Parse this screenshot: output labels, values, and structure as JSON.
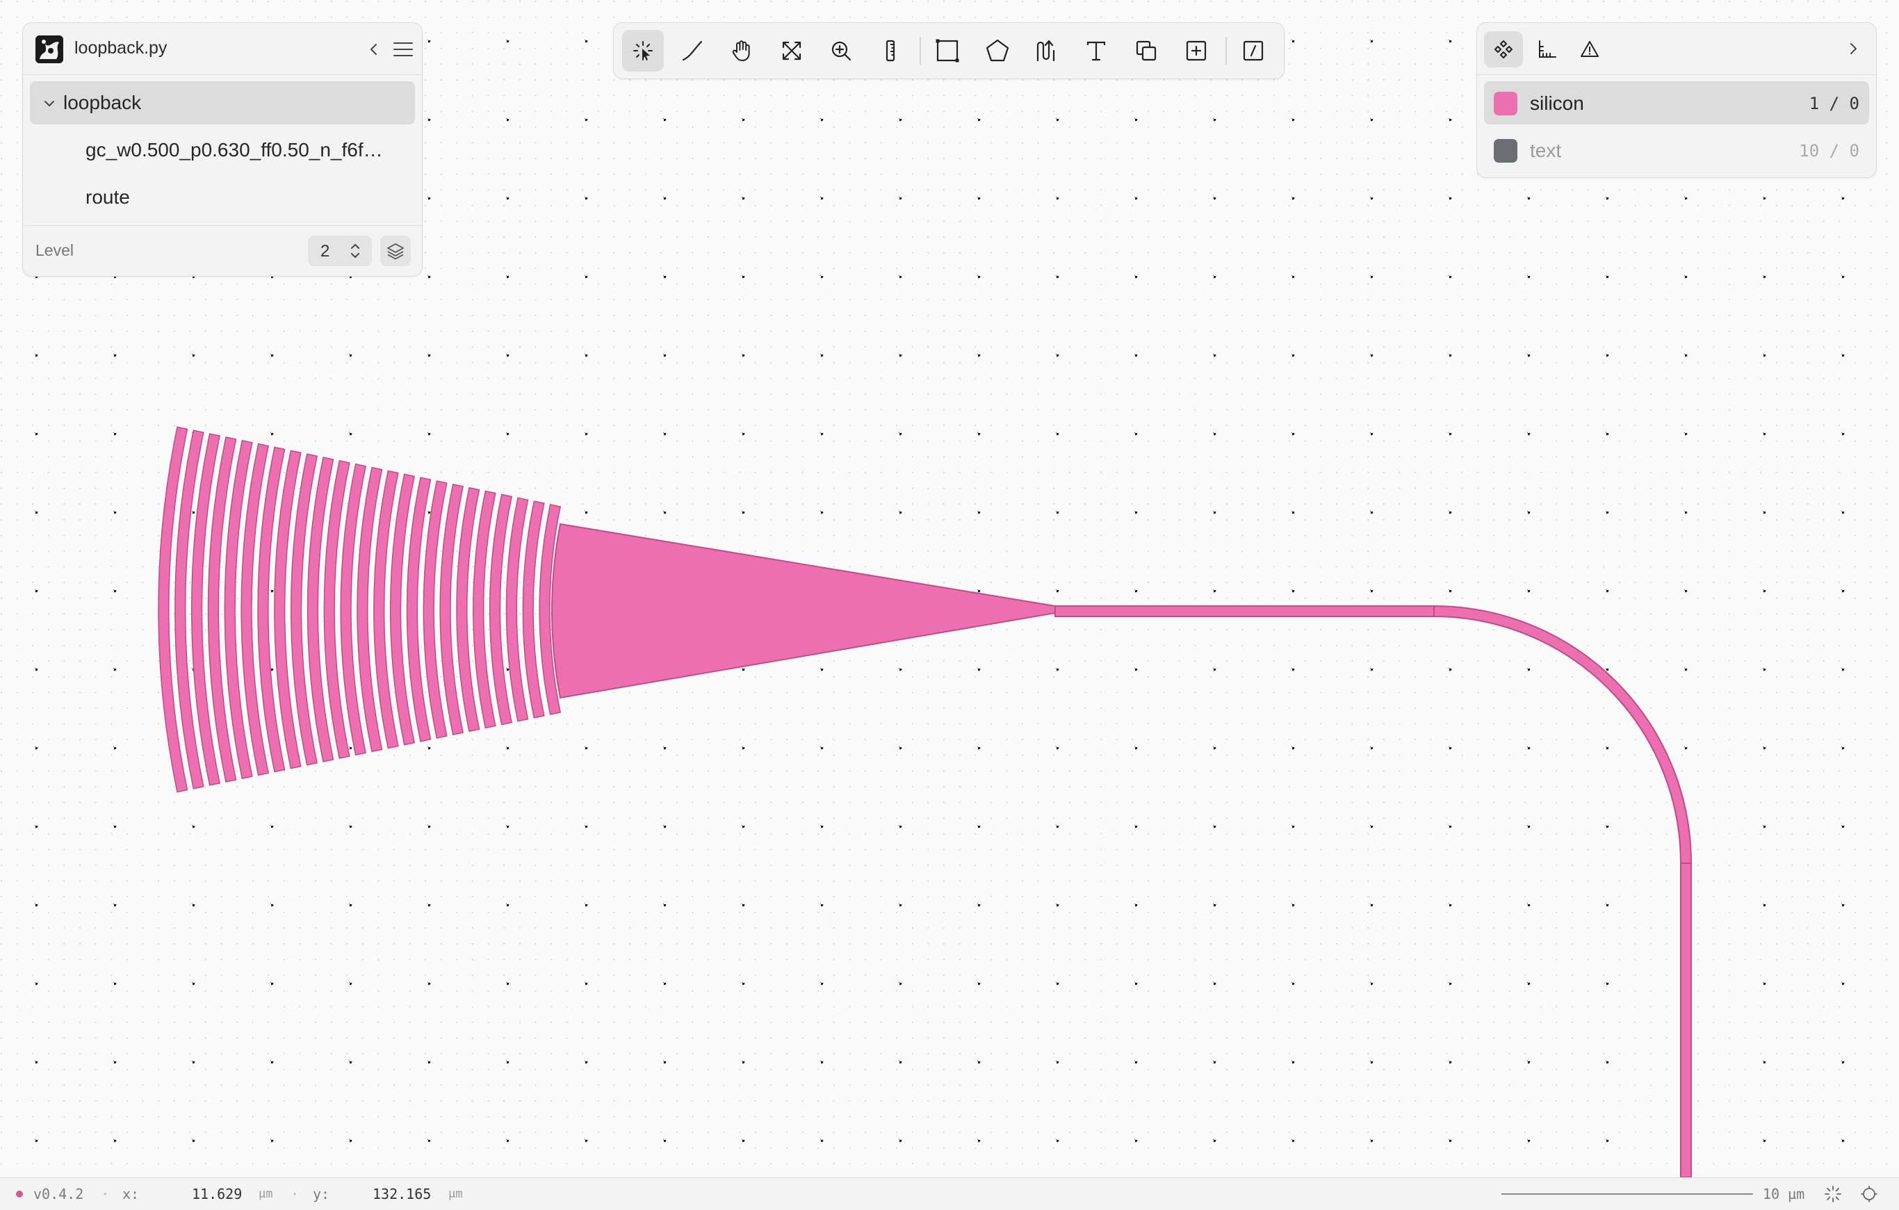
{
  "colors": {
    "accent": "#ec6fb0",
    "accent_stroke": "#c24b87",
    "text_layer": "#6b6f73",
    "canvas_bg": "#fafafa",
    "grid_dot": "#1a1a1a"
  },
  "left_panel": {
    "file_name": "loopback.py",
    "collapse_icon": "chevron-left-icon",
    "menu_icon": "hamburger-menu-icon",
    "tree": [
      {
        "label": "loopback",
        "expanded": true,
        "selected": true
      },
      {
        "label": "gc_w0.500_p0.630_ff0.50_n_f6f…",
        "selected": false
      },
      {
        "label": "route",
        "selected": false
      }
    ],
    "level_label": "Level",
    "level_value": "2"
  },
  "toolbar": {
    "tools": [
      {
        "name": "select",
        "icon": "select-pointer-icon",
        "active": true
      },
      {
        "name": "path",
        "icon": "line-icon",
        "active": false
      },
      {
        "name": "pan",
        "icon": "hand-icon",
        "active": false
      },
      {
        "name": "fit",
        "icon": "fit-view-icon",
        "active": false
      },
      {
        "name": "zoom",
        "icon": "zoom-in-icon",
        "active": false
      },
      {
        "name": "ruler",
        "icon": "ruler-icon",
        "active": false
      },
      {
        "name": "rectangle",
        "icon": "rectangle-icon",
        "active": false
      },
      {
        "name": "polygon",
        "icon": "pentagon-icon",
        "active": false
      },
      {
        "name": "route",
        "icon": "route-icon",
        "active": false
      },
      {
        "name": "text",
        "icon": "text-icon",
        "active": false
      },
      {
        "name": "copy",
        "icon": "copy-icon",
        "active": false
      },
      {
        "name": "add-instance",
        "icon": "add-box-icon",
        "active": false
      },
      {
        "name": "script",
        "icon": "slash-box-icon",
        "active": false
      }
    ]
  },
  "right_panel": {
    "tabs": [
      {
        "name": "layers",
        "icon": "layers-diamond-icon",
        "active": true
      },
      {
        "name": "ports",
        "icon": "axis-icon",
        "active": false
      },
      {
        "name": "warnings",
        "icon": "warning-icon",
        "active": false
      }
    ],
    "expand_icon": "chevron-right-icon",
    "layers": [
      {
        "name": "silicon",
        "count": "1 / 0",
        "color": "#ec6fb0",
        "selected": true
      },
      {
        "name": "text",
        "count": "10 / 0",
        "color": "#6b6f73",
        "selected": false
      }
    ]
  },
  "status_bar": {
    "version": "v0.4.2",
    "x_label": "x:",
    "x_value": "11.629",
    "y_label": "y:",
    "y_value": "132.165",
    "unit": "µm",
    "scale_label": "10 µm"
  }
}
